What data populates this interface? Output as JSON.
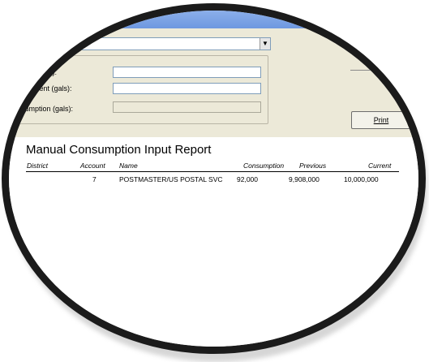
{
  "toolbar": {
    "print_label": "Print"
  },
  "form": {
    "previous_label": "us (gals):",
    "current_label": "Current (gals):",
    "consumption_label": "nsumption (gals):",
    "previous_value": "",
    "current_value": "",
    "consumption_value": "",
    "dropdown_value": ""
  },
  "report": {
    "title": "Manual Consumption Input Report",
    "columns": [
      "District",
      "Account",
      "Name",
      "Consumption",
      "Previous",
      "Current"
    ],
    "rows": [
      {
        "district": "",
        "account": "7",
        "name": "POSTMASTER/US POSTAL SVC",
        "consumption": "92,000",
        "previous": "9,908,000",
        "current": "10,000,000"
      }
    ]
  },
  "colors": {
    "title_bar": "#6e98e0",
    "dialog_bg": "#ece9d8",
    "lens_ring": "#1b1b1b"
  }
}
